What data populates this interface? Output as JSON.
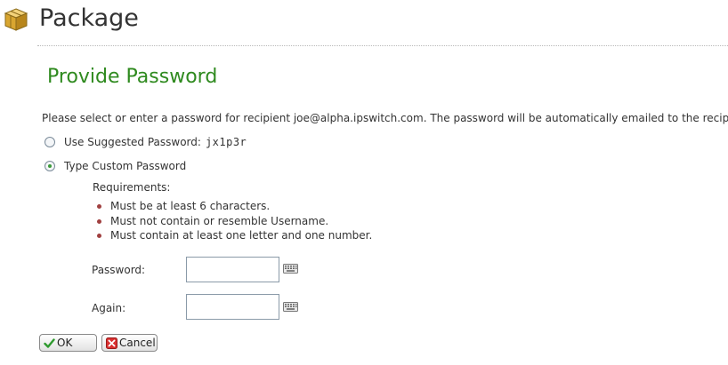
{
  "header": {
    "title": "Package",
    "icon": "package-icon"
  },
  "section": {
    "title": "Provide Password"
  },
  "instructions": "Please select or enter a password for recipient joe@alpha.ipswitch.com. The password will be automatically emailed to the recipient.",
  "options": {
    "suggested": {
      "label": "Use Suggested Password:",
      "value": "jx1p3r",
      "selected": false
    },
    "custom": {
      "label": "Type Custom Password",
      "selected": true
    }
  },
  "requirements": {
    "title": "Requirements:",
    "items": [
      "Must be at least 6 characters.",
      "Must not contain or resemble Username.",
      "Must contain at least one letter and one number."
    ]
  },
  "fields": {
    "password": {
      "label": "Password:",
      "value": ""
    },
    "again": {
      "label": "Again:",
      "value": ""
    }
  },
  "buttons": {
    "ok": {
      "label": "OK",
      "icon": "checkmark-icon"
    },
    "cancel": {
      "label": "Cancel",
      "icon": "x-icon"
    }
  },
  "colors": {
    "section_title": "#2f8a1f",
    "ok_icon": "#2e9a2e",
    "cancel_icon": "#cc2222"
  }
}
